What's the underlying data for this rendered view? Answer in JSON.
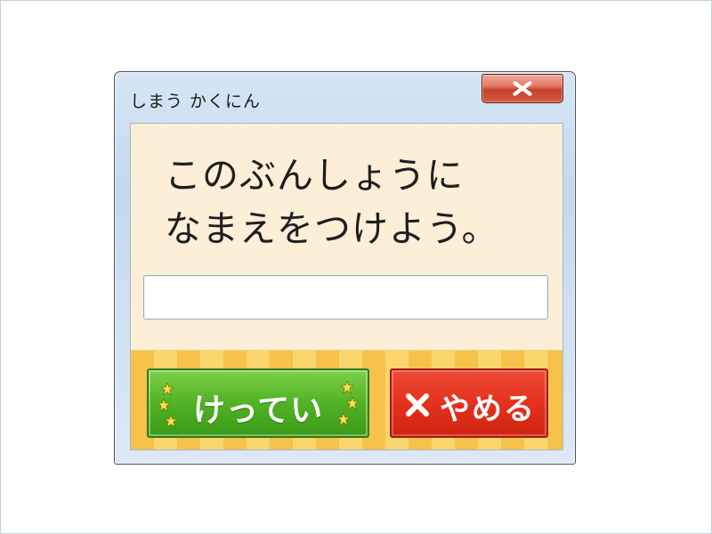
{
  "window": {
    "title": "しまう かくにん"
  },
  "dialog": {
    "message_line1": "このぶんしょうに",
    "message_line2": "なまえをつけよう。",
    "name_input_value": "",
    "decide_label": "けってい",
    "cancel_label": "やめる"
  },
  "icons": {
    "close": "close-icon",
    "decide_decoration": "star-icon",
    "cancel": "x-icon"
  },
  "colors": {
    "panel_background": "#fdeed8",
    "button_bar": "#f7c64a",
    "decide_button": "#4bab22",
    "cancel_button": "#e3301c",
    "close_button": "#d35a43"
  }
}
